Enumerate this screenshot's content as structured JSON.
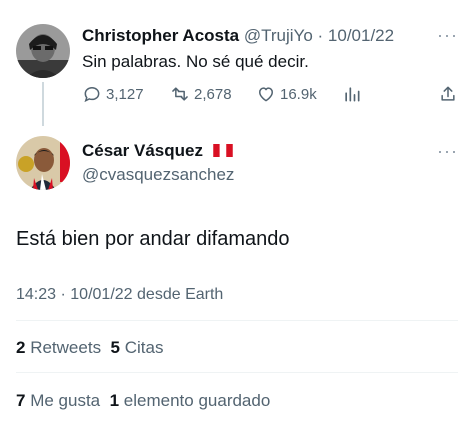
{
  "reply_to_tweet": {
    "author_name": "Christopher Acosta",
    "handle": "@TrujiYo",
    "separator": "·",
    "date": "10/01/22",
    "text": "Sin palabras. No sé qué decir.",
    "actions": {
      "replies": "3,127",
      "retweets": "2,678",
      "likes": "16.9k"
    },
    "icons": [
      "reply-icon",
      "retweet-icon",
      "like-icon",
      "analytics-icon",
      "share-icon",
      "more-icon"
    ]
  },
  "main_tweet": {
    "author_name": "César Vásquez",
    "flag": "peru-flag",
    "handle": "@cvasquezsanchez",
    "text": "Está bien por andar difamando",
    "time": "14:23",
    "date": "10/01/22",
    "source_prefix": "desde",
    "source": "Earth",
    "separator": "·",
    "stats": {
      "retweets_count": "2",
      "retweets_label": "Retweets",
      "quotes_count": "5",
      "quotes_label": "Citas",
      "likes_count": "7",
      "likes_label": "Me gusta",
      "bookmarks_count": "1",
      "bookmarks_label": "elemento guardado"
    }
  },
  "colors": {
    "text": "#0f1419",
    "muted": "#536471",
    "divider": "#eff3f4",
    "thread_line": "#cfd9de"
  }
}
